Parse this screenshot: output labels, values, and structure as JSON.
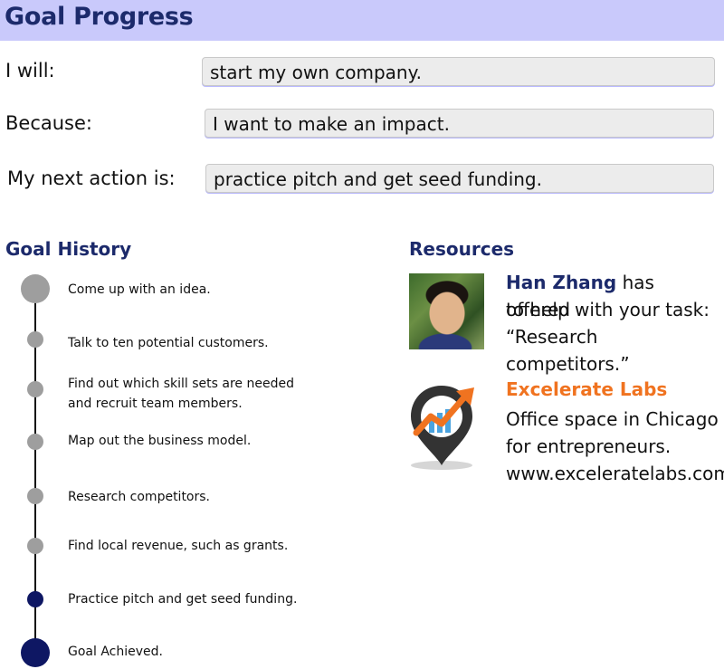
{
  "header": {
    "title": "Goal Progress"
  },
  "goal_form": {
    "will": {
      "label": "I will:",
      "value": "start my own company."
    },
    "because": {
      "label": "Because:",
      "value": "I want to make an impact."
    },
    "next_action": {
      "label": "My next action is:",
      "value": "practice pitch and get seed funding."
    }
  },
  "history": {
    "heading": "Goal History",
    "steps": [
      {
        "label": "Come up with an idea.",
        "status": "completed"
      },
      {
        "label": "Talk to ten potential customers.",
        "status": "completed"
      },
      {
        "label": "Find out which skill sets are needed and recruit team members.",
        "status": "completed"
      },
      {
        "label": "Map out the business model.",
        "status": "completed"
      },
      {
        "label": "Research competitors.",
        "status": "completed"
      },
      {
        "label": "Find local revenue, such as grants.",
        "status": "completed"
      },
      {
        "label": "Practice pitch and get seed funding.",
        "status": "current"
      },
      {
        "label": "Goal Achieved.",
        "status": "goal"
      }
    ]
  },
  "resources": {
    "heading": "Resources",
    "person": {
      "name": "Han Zhang",
      "line1_rest": " has offered",
      "line2": "to help with your task:",
      "line3": "“Research competitors.”"
    },
    "organization": {
      "name": "Excelerate Labs",
      "line1": "Office space in Chicago",
      "line2": "for entrepreneurs.",
      "url": "www.exceleratelabs.com",
      "icon": "map-pin-growth-icon"
    }
  },
  "colors": {
    "header_bg": "#c9c9fb",
    "heading": "#1c2a6b",
    "completed_dot": "#9e9e9e",
    "current_dot": "#0e1763",
    "brand_orange": "#f07320"
  }
}
